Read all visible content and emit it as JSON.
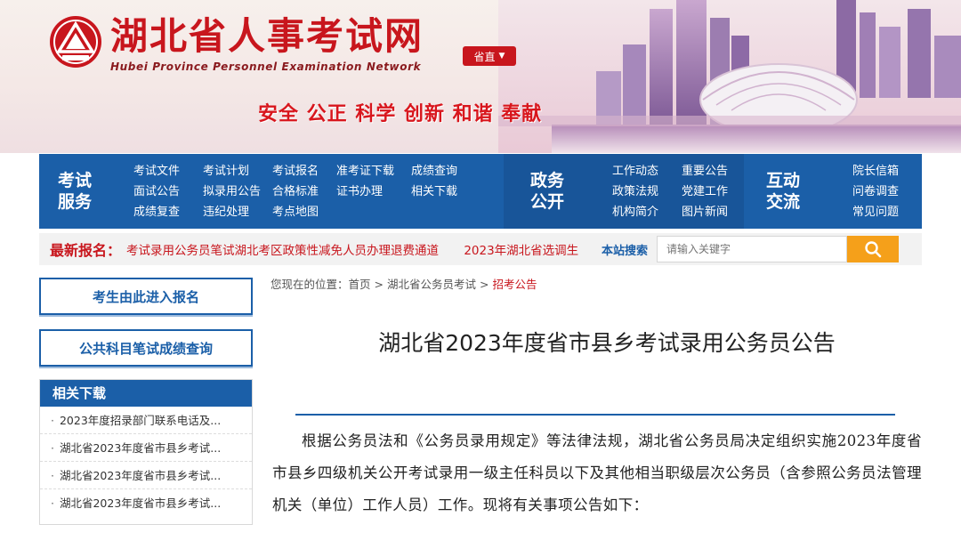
{
  "header": {
    "logo_text": "湖北省人事考试网",
    "logo_en": "Hubei Province Personnel Examination Network",
    "region_label": "省直",
    "slogan": "安全 公正 科学 创新 和谐 奉献"
  },
  "nav": {
    "exam_service": {
      "title_lines": [
        "考试",
        "服务"
      ],
      "links": [
        "考试文件",
        "考试计划",
        "考试报名",
        "准考证下载",
        "成绩查询",
        "面试公告",
        "拟录用公告",
        "合格标准",
        "证书办理",
        "相关下载",
        "成绩复查",
        "违纪处理",
        "考点地图"
      ]
    },
    "gov_affairs": {
      "title_lines": [
        "政务",
        "公开"
      ],
      "links": [
        "工作动态",
        "重要公告",
        "政策法规",
        "党建工作",
        "机构简介",
        "图片新闻"
      ]
    },
    "interaction": {
      "title_lines": [
        "互动",
        "交流"
      ],
      "links": [
        "院长信箱",
        "问卷调查",
        "常见问题"
      ]
    }
  },
  "latest": {
    "label": "最新报名：",
    "items": [
      "考试录用公务员笔试湖北考区政策性减免人员办理退费通道",
      "2023年湖北省选调生"
    ]
  },
  "search": {
    "label": "本站搜索",
    "placeholder": "请输入关键字"
  },
  "sidebar": {
    "entry_button": "考生由此进入报名",
    "score_button": "公共科目笔试成绩查询",
    "downloads_title": "相关下载",
    "downloads": [
      "2023年度招录部门联系电话及...",
      "湖北省2023年度省市县乡考试...",
      "湖北省2023年度省市县乡考试...",
      "湖北省2023年度省市县乡考试..."
    ]
  },
  "breadcrumb": {
    "prefix": "您现在的位置：",
    "home": "首页",
    "section": "湖北省公务员考试",
    "current": "招考公告"
  },
  "article": {
    "title": "湖北省2023年度省市县乡考试录用公务员公告",
    "body": "根据公务员法和《公务员录用规定》等法律法规，湖北省公务员局决定组织实施2023年度省市县乡四级机关公开考试录用一级主任科员以下及其他相当职级层次公务员（含参照公务员法管理机关（单位）工作人员）工作。现将有关事项公告如下："
  },
  "colors": {
    "brand_red": "#c8161d",
    "nav_blue": "#1b5fa8",
    "search_orange": "#f5a01a"
  }
}
